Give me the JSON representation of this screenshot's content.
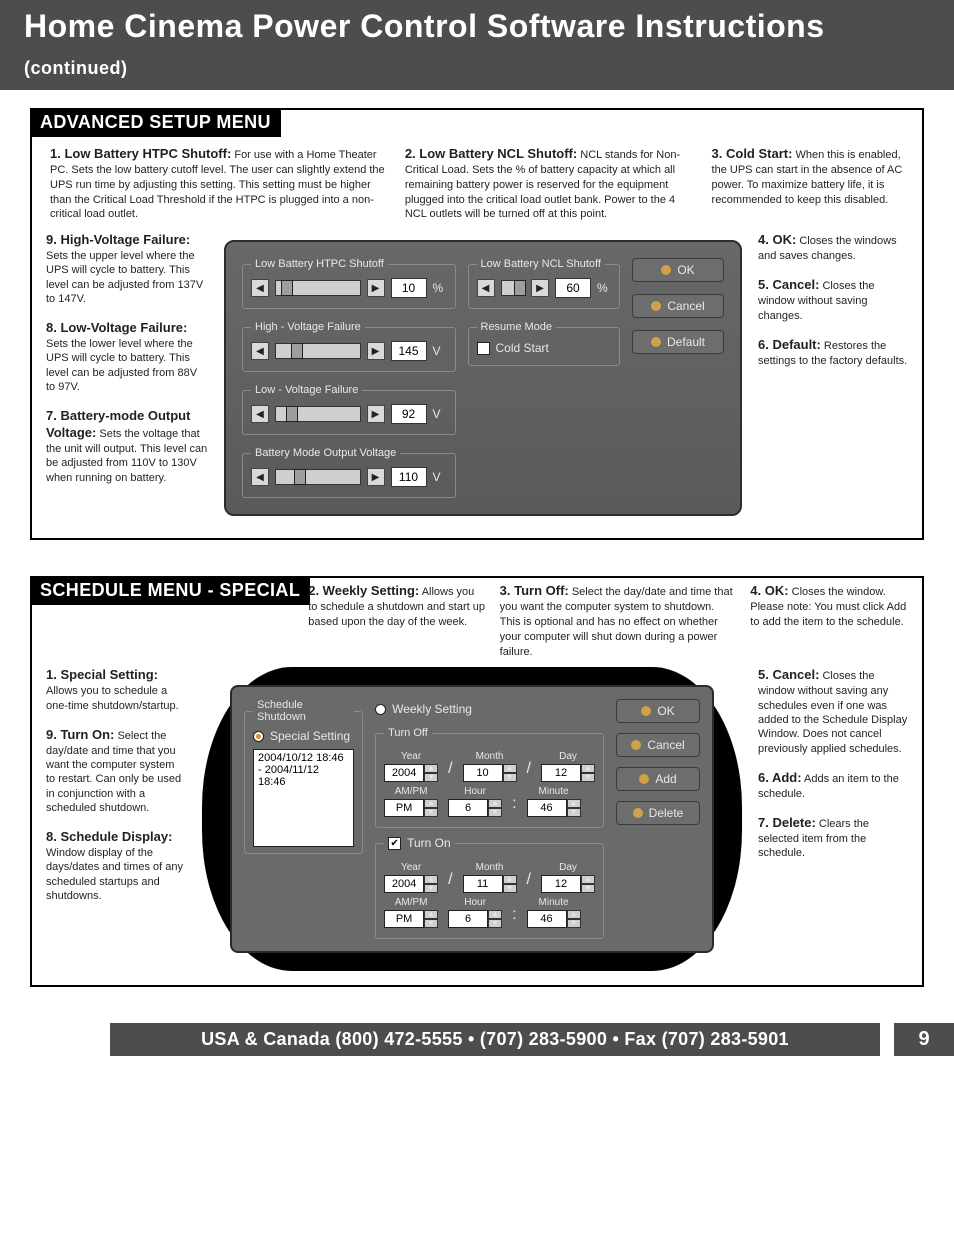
{
  "title": "Home Cinema Power Control Software Instructions",
  "title_suffix": "(continued)",
  "footer": {
    "contact": "USA & Canada (800) 472-5555 • (707) 283-5900 • Fax (707) 283-5901",
    "page": "9"
  },
  "adv": {
    "heading": "ADVANCED SETUP MENU",
    "top": {
      "n1": {
        "t": "1. Low Battery HTPC Shutoff:",
        "d": "For use with a Home Theater PC. Sets the low battery cutoff level. The user can slightly extend the UPS run time by adjusting this setting. This setting must be higher than the Critical Load Threshold if the HTPC is plugged into a non-critical load outlet."
      },
      "n2": {
        "t": "2. Low Battery NCL Shutoff:",
        "d": "NCL stands for Non-Critical Load. Sets the % of battery capacity at which all remaining battery power is reserved for the equipment plugged into the critical load outlet bank. Power to the 4 NCL outlets will be turned off at this point."
      },
      "n3": {
        "t": "3. Cold Start:",
        "d": "When this is enabled, the UPS can start in the absence of AC power. To maximize battery life, it is recommended to keep this disabled."
      }
    },
    "left": {
      "n9": {
        "t": "9. High-Voltage Failure:",
        "d": "Sets the upper level where the UPS will cycle to battery. This level can be adjusted from 137V to 147V."
      },
      "n8": {
        "t": "8. Low-Voltage Failure:",
        "d": "Sets the lower level where the UPS will cycle to battery. This level can be adjusted from 88V to 97V."
      },
      "n7": {
        "t": "7. Battery-mode Output Voltage:",
        "d": "Sets the voltage that the unit will output. This level can be adjusted from 110V to 130V when running on battery."
      }
    },
    "right": {
      "n4": {
        "t": "4. OK:",
        "d": "Closes the windows and saves changes."
      },
      "n5": {
        "t": "5. Cancel:",
        "d": "Closes the window without saving changes."
      },
      "n6": {
        "t": "6. Default:",
        "d": "Restores the settings to the factory defaults."
      }
    },
    "dlg": {
      "htpc": {
        "legend": "Low Battery HTPC Shutoff",
        "val": "10",
        "unit": "%"
      },
      "ncl": {
        "legend": "Low Battery NCL Shutoff",
        "val": "60",
        "unit": "%"
      },
      "hv": {
        "legend": "High - Voltage Failure",
        "val": "145",
        "unit": "V"
      },
      "lv": {
        "legend": "Low - Voltage Failure",
        "val": "92",
        "unit": "V"
      },
      "bmov": {
        "legend": "Battery Mode Output Voltage",
        "val": "110",
        "unit": "V"
      },
      "resume": {
        "legend": "Resume Mode",
        "cold": "Cold Start"
      },
      "btn_ok": "OK",
      "btn_cancel": "Cancel",
      "btn_default": "Default"
    }
  },
  "sched": {
    "heading": "SCHEDULE MENU - SPECIAL",
    "top": {
      "n2": {
        "t": "2. Weekly Setting:",
        "d": "Allows you to schedule a shutdown and start up based upon the day of the week."
      },
      "n3": {
        "t": "3. Turn Off:",
        "d": "Select the day/date and time that you want the computer system to shutdown. This is optional and has no effect on whether your computer will shut down during a power failure."
      },
      "n4": {
        "t": "4. OK:",
        "d": "Closes the window. Please note: You must click Add to add the item to the schedule."
      }
    },
    "left": {
      "n1": {
        "t": "1. Special Setting:",
        "d": "Allows you to schedule a one-time shutdown/startup."
      },
      "n9": {
        "t": "9. Turn On:",
        "d": "Select the day/date and time that you want the computer system to restart. Can only be used in conjunction with a scheduled shutdown."
      },
      "n8": {
        "t": "8. Schedule Display:",
        "d": "Window display of the days/dates and times of any scheduled startups and shutdowns."
      }
    },
    "right": {
      "n5": {
        "t": "5. Cancel:",
        "d": "Closes the window without saving any schedules even if one was added to the Schedule Display Window. Does not cancel previously applied schedules."
      },
      "n6": {
        "t": "6. Add:",
        "d": "Adds an item to the schedule."
      },
      "n7": {
        "t": "7. Delete:",
        "d": "Clears the selected item from the schedule."
      }
    },
    "dlg": {
      "title": "Schedule Shutdown",
      "special": "Special Setting",
      "weekly": "Weekly Setting",
      "entry": "2004/10/12 18:46 - 2004/11/12 18:46",
      "off": {
        "legend": "Turn Off",
        "year_l": "Year",
        "month_l": "Month",
        "day_l": "Day",
        "ampm_l": "AM/PM",
        "hour_l": "Hour",
        "min_l": "Minute",
        "year": "2004",
        "month": "10",
        "day": "12",
        "ampm": "PM",
        "hour": "6",
        "min": "46"
      },
      "on": {
        "legend": "Turn On",
        "year_l": "Year",
        "month_l": "Month",
        "day_l": "Day",
        "ampm_l": "AM/PM",
        "hour_l": "Hour",
        "min_l": "Minute",
        "year": "2004",
        "month": "11",
        "day": "12",
        "ampm": "PM",
        "hour": "6",
        "min": "46"
      },
      "btn_ok": "OK",
      "btn_cancel": "Cancel",
      "btn_add": "Add",
      "btn_delete": "Delete"
    }
  }
}
